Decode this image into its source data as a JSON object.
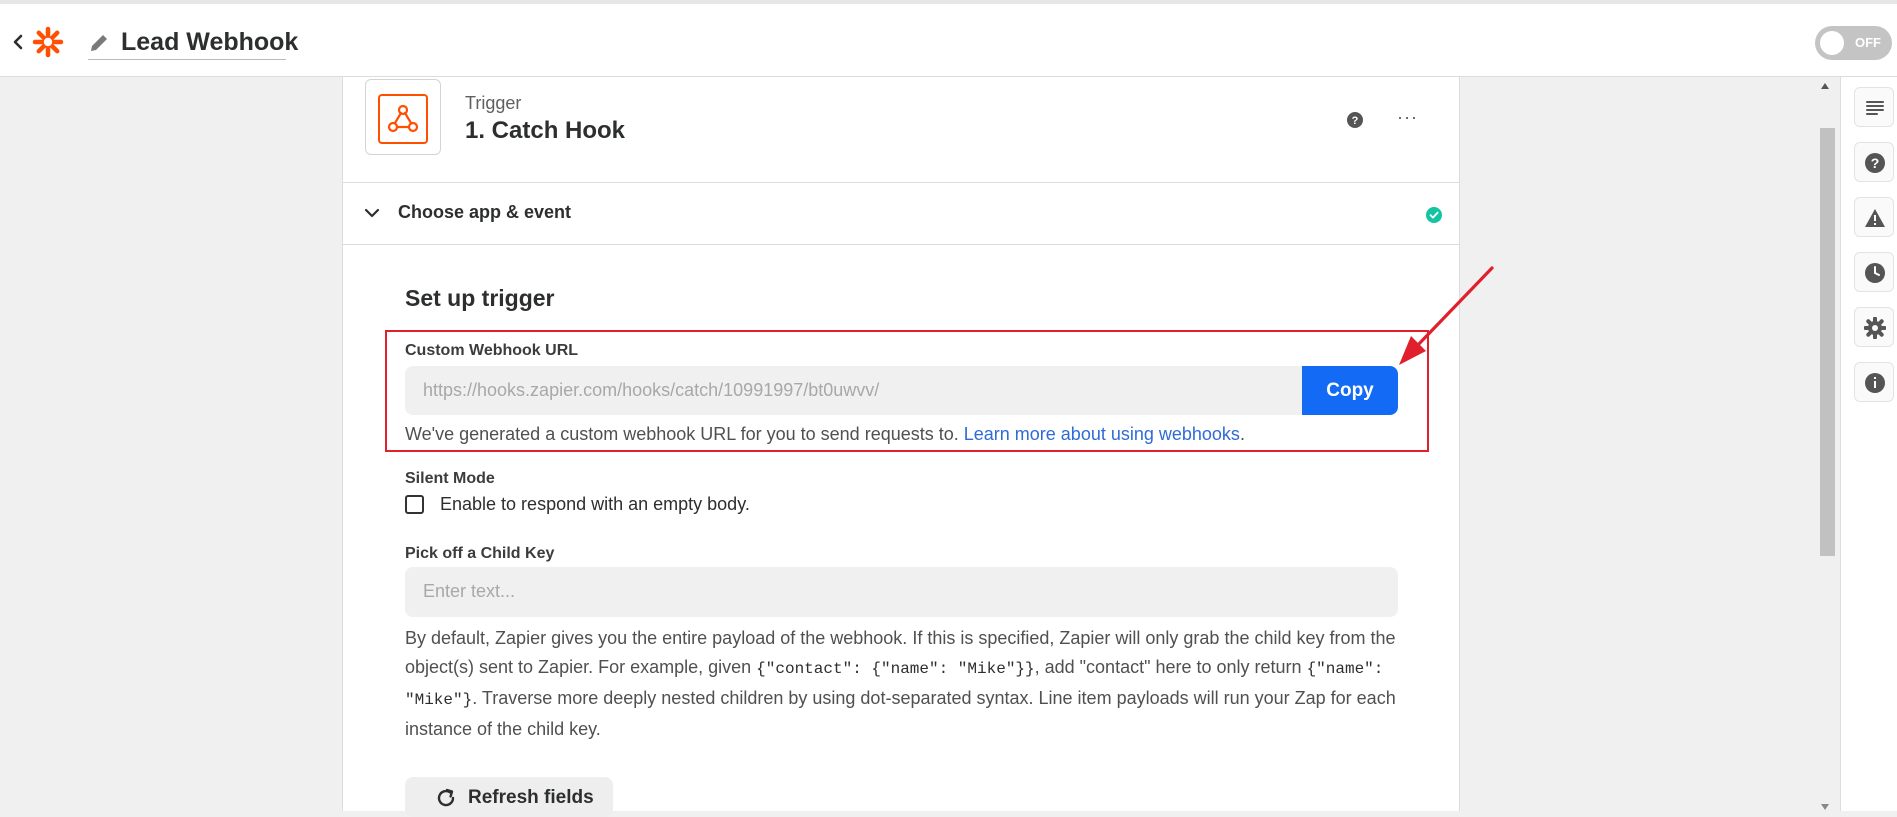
{
  "header": {
    "zap_title": "Lead Webhook",
    "toggle_label": "OFF",
    "icons": [
      "back-icon",
      "zapier-logo-icon",
      "pencil-icon"
    ]
  },
  "step": {
    "kind": "Trigger",
    "name": "1. Catch Hook",
    "app_icon": "webhook-icon",
    "icons": [
      "help-icon",
      "more-icon"
    ]
  },
  "choose_section": {
    "label": "Choose app & event",
    "status": "complete"
  },
  "setup": {
    "title": "Set up trigger",
    "webhook_url": {
      "label": "Custom Webhook URL",
      "value": "https://hooks.zapier.com/hooks/catch/10991997/bt0uwvv/",
      "copy_label": "Copy",
      "help_text": "We've generated a custom webhook URL for you to send requests to. ",
      "help_link": "Learn more about using webhooks",
      "help_end": "."
    },
    "silent_mode": {
      "label": "Silent Mode",
      "checkbox_label": "Enable to respond with an empty body.",
      "checked": false
    },
    "child_key": {
      "label": "Pick off a Child Key",
      "placeholder": "Enter text...",
      "desc_1": "By default, Zapier gives you the entire payload of the webhook. If this is specified, Zapier will only grab the child key from the object(s) sent to Zapier. For example, given ",
      "code_1": "{\"contact\": {\"name\": \"Mike\"}}",
      "desc_2": ", add \"contact\" here to only return ",
      "code_2": "{\"name\": \"Mike\"}",
      "desc_3": ". Traverse more deeply nested children by using dot-separated syntax. Line item payloads will run your Zap for each instance of the child key."
    },
    "refresh_label": "Refresh fields"
  },
  "right_rail": {
    "icons": [
      "details-icon",
      "help-icon",
      "alert-icon",
      "history-icon",
      "settings-icon",
      "info-icon"
    ]
  },
  "colors": {
    "accent": "#136bf5",
    "brand": "#ff4f00",
    "highlight": "#e0202c",
    "success": "#13c4a3"
  }
}
